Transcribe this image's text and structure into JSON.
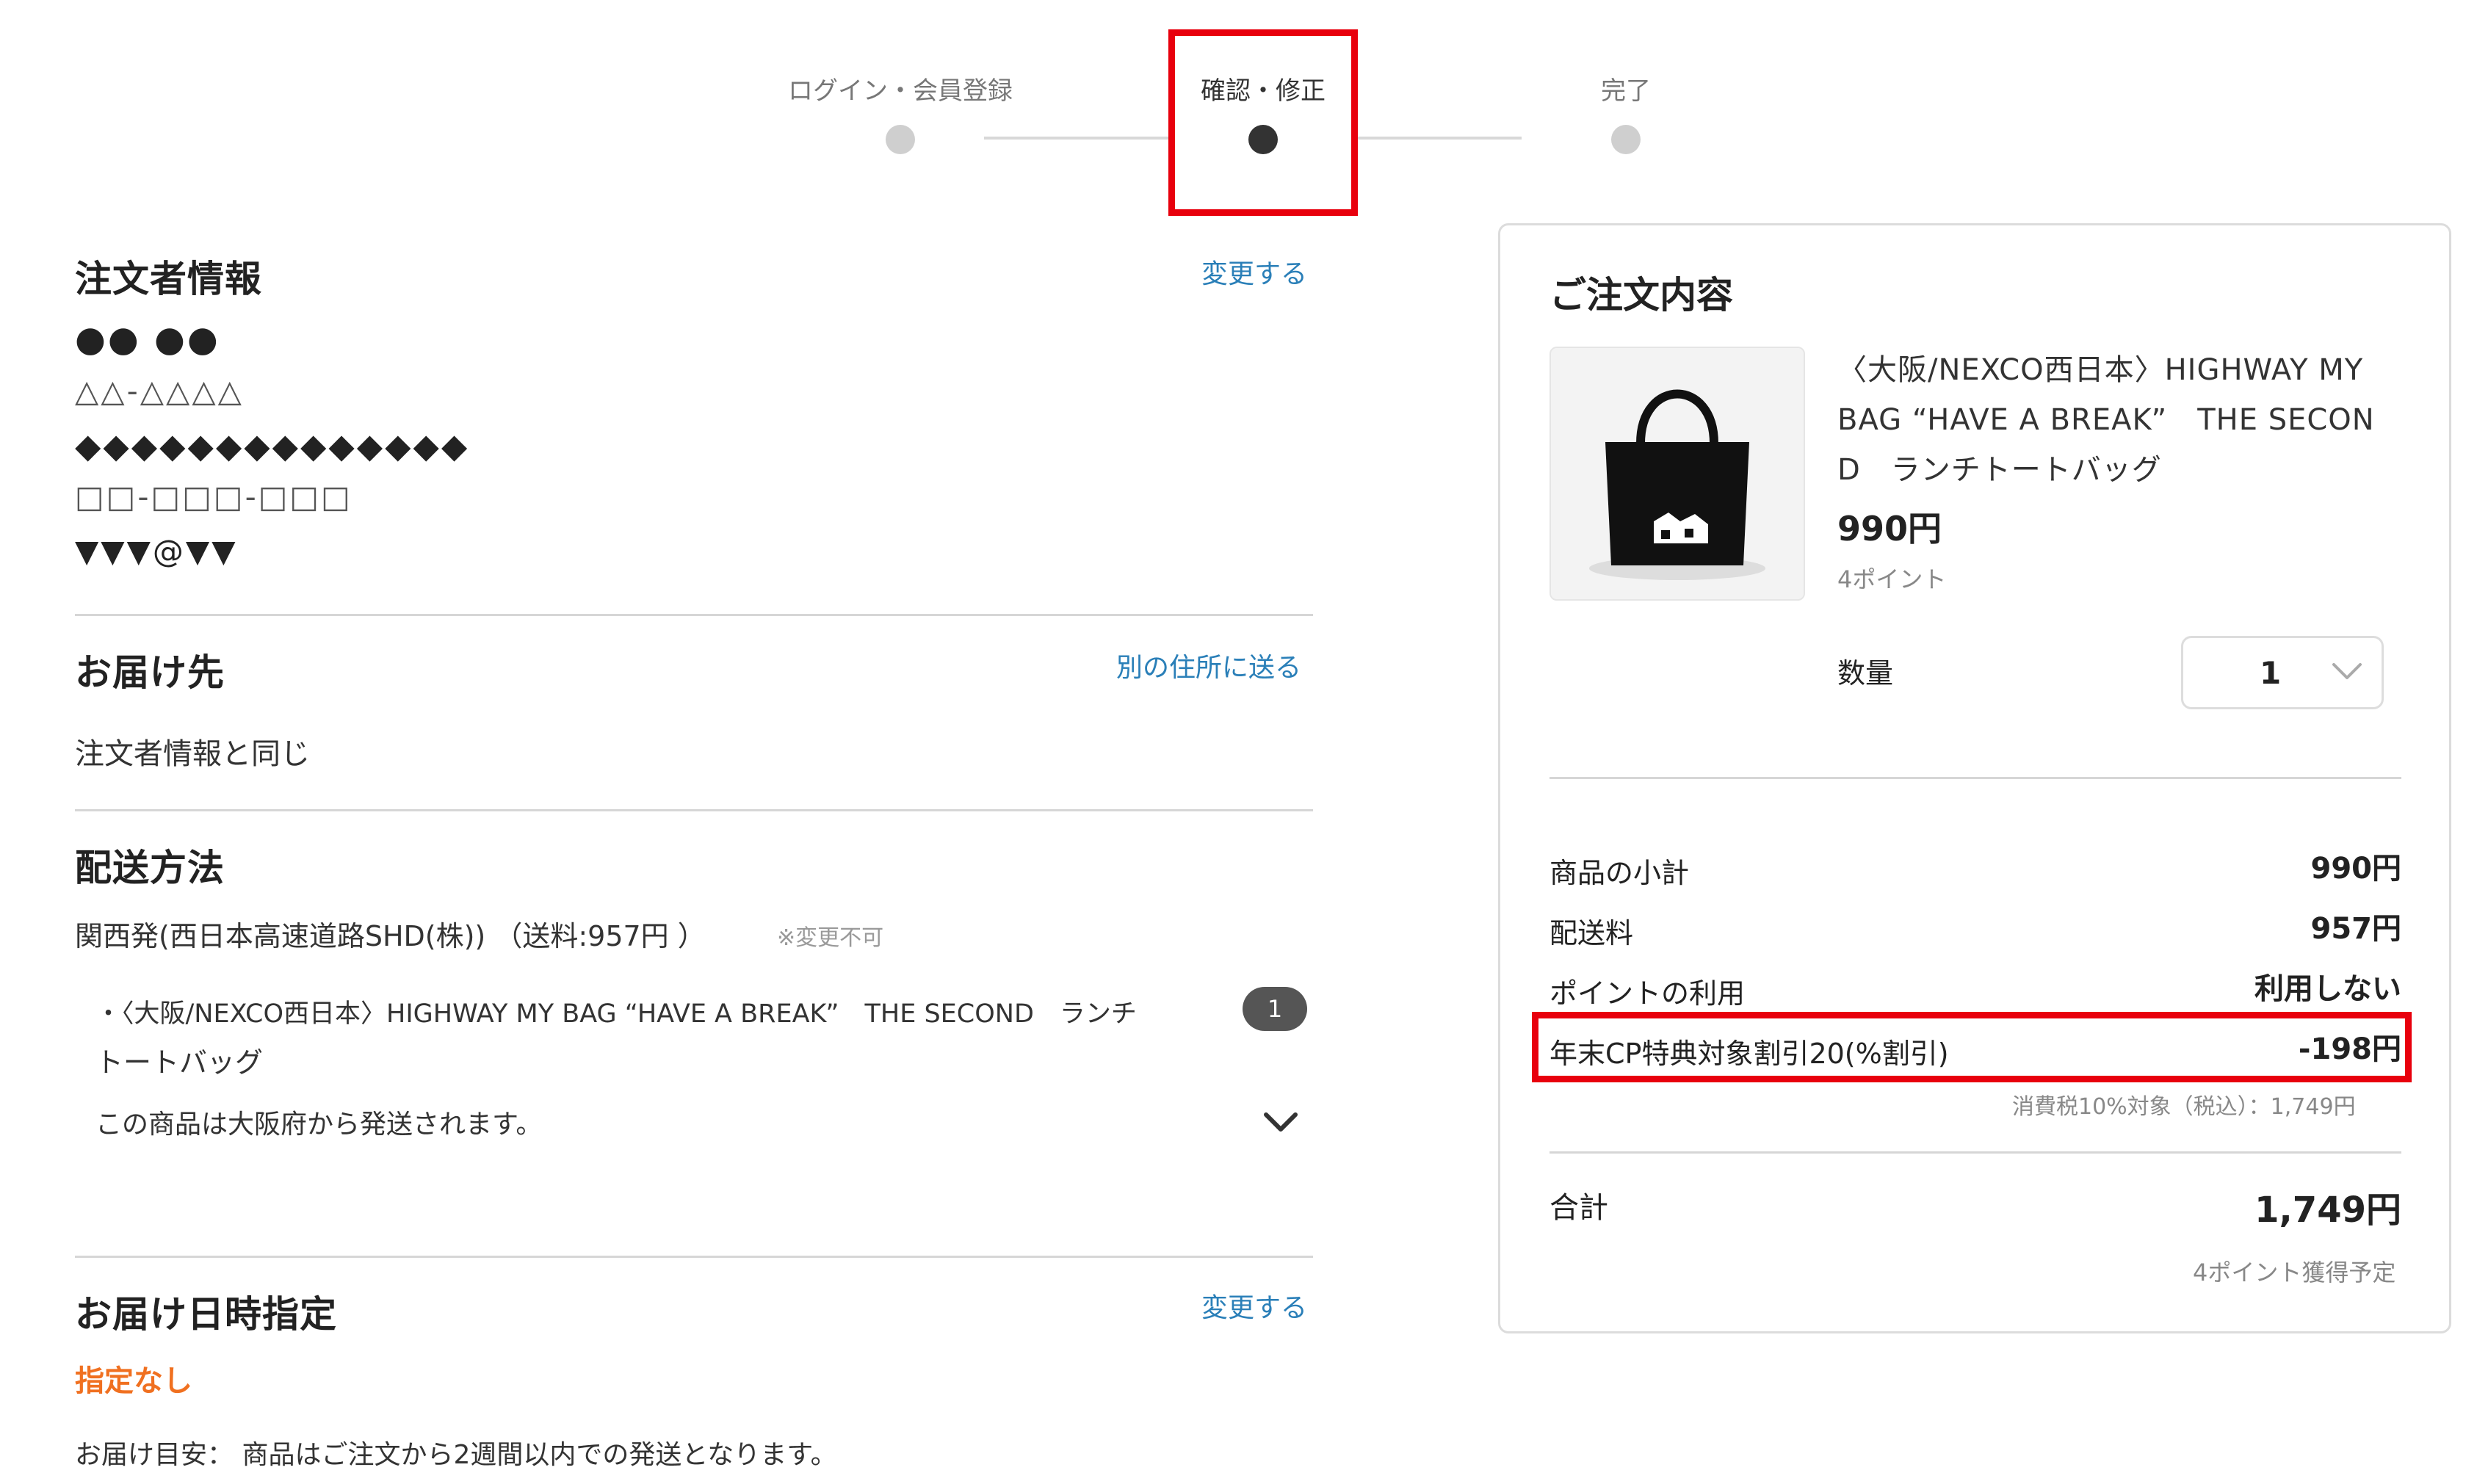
{
  "stepper": {
    "steps": [
      {
        "label": "ログイン・会員登録"
      },
      {
        "label": "確認・修正"
      },
      {
        "label": "完了"
      }
    ]
  },
  "orderer": {
    "title": "注文者情報",
    "change_link": "変更する",
    "lines": [
      "●● ●●",
      "△△-△△△△",
      "◆◆◆◆◆◆◆◆◆◆◆◆◆◆",
      "□□-□□□-□□□",
      "▼▼▼@▼▼"
    ]
  },
  "delivery_address": {
    "title": "お届け先",
    "link": "別の住所に送る",
    "value": "注文者情報と同じ"
  },
  "shipping": {
    "title": "配送方法",
    "method": "関西発(西日本高速道路SHD(株)) （送料:957円 ）",
    "note": "※変更不可",
    "item_line1": "・〈大阪/NEXCO西日本〉HIGHWAY MY BAG “HAVE A BREAK”　THE SECOND　ランチ",
    "item_line2": "トートバッグ",
    "item_qty": "1",
    "origin": "この商品は大阪府から発送されます。"
  },
  "delivery_datetime": {
    "title": "お届け日時指定",
    "change_link": "変更する",
    "value": "指定なし",
    "estimate": "お届け目安： 商品はご注文から2週間以内での発送となります。"
  },
  "order_summary": {
    "title": "ご注文内容",
    "product": {
      "name_lines": [
        "〈大阪/NEXCO西日本〉HIGHWAY MY",
        "BAG “HAVE A BREAK”　THE SECON",
        "D　ランチトートバッグ"
      ],
      "price": "990円",
      "points": "4ポイント"
    },
    "quantity_label": "数量",
    "quantity_value": "1",
    "rows": [
      {
        "label": "商品の小計",
        "value": "990円"
      },
      {
        "label": "配送料",
        "value": "957円"
      },
      {
        "label": "ポイントの利用",
        "value": "利用しない"
      },
      {
        "label": "年末CP特典対象割引20(%割引)",
        "value": "-198円"
      }
    ],
    "tax_note": "消費税10%対象（税込）：1,749円",
    "total_label": "合計",
    "total_value": "1,749円",
    "points_earned": "4ポイント獲得予定"
  },
  "colors": {
    "accent_link": "#2a7fb8",
    "highlight": "#e8000d",
    "warning": "#f07020"
  }
}
